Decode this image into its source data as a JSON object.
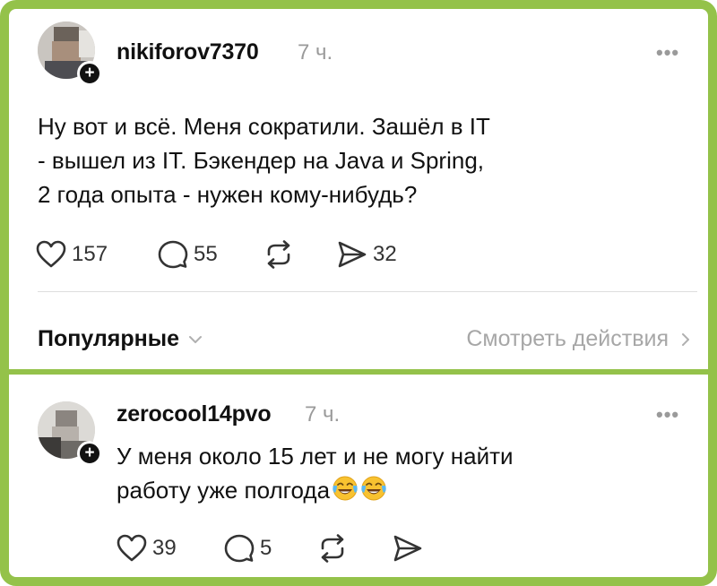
{
  "post": {
    "username": "nikiforov7370",
    "time": "7 ч.",
    "more": "•••",
    "lines": [
      "Ну вот и всё. Меня сократили. Зашёл в IT",
      "- вышел из IT. Бэкендер на Java и Spring,",
      "2 года опыта - нужен кому-нибудь?"
    ],
    "likes": "157",
    "comments": "55",
    "shares": "32"
  },
  "bar": {
    "sort_label": "Популярные",
    "view_activity": "Смотреть действия"
  },
  "reply": {
    "username": "zerocool14pvo",
    "time": "7 ч.",
    "more": "•••",
    "line1": "У меня около 15 лет и не могу найти",
    "line2": "работу уже полгода",
    "emojis": [
      "face-with-tears-of-joy",
      "face-with-tears-of-joy"
    ],
    "likes": "39",
    "comments": "5"
  },
  "colors": {
    "frame": "#94c24a",
    "muted": "#9a9a9a",
    "text": "#111111"
  },
  "icons": [
    "heart-icon",
    "comment-icon",
    "repost-icon",
    "send-icon",
    "chevron-down-icon",
    "chevron-right-icon",
    "plus-icon"
  ]
}
